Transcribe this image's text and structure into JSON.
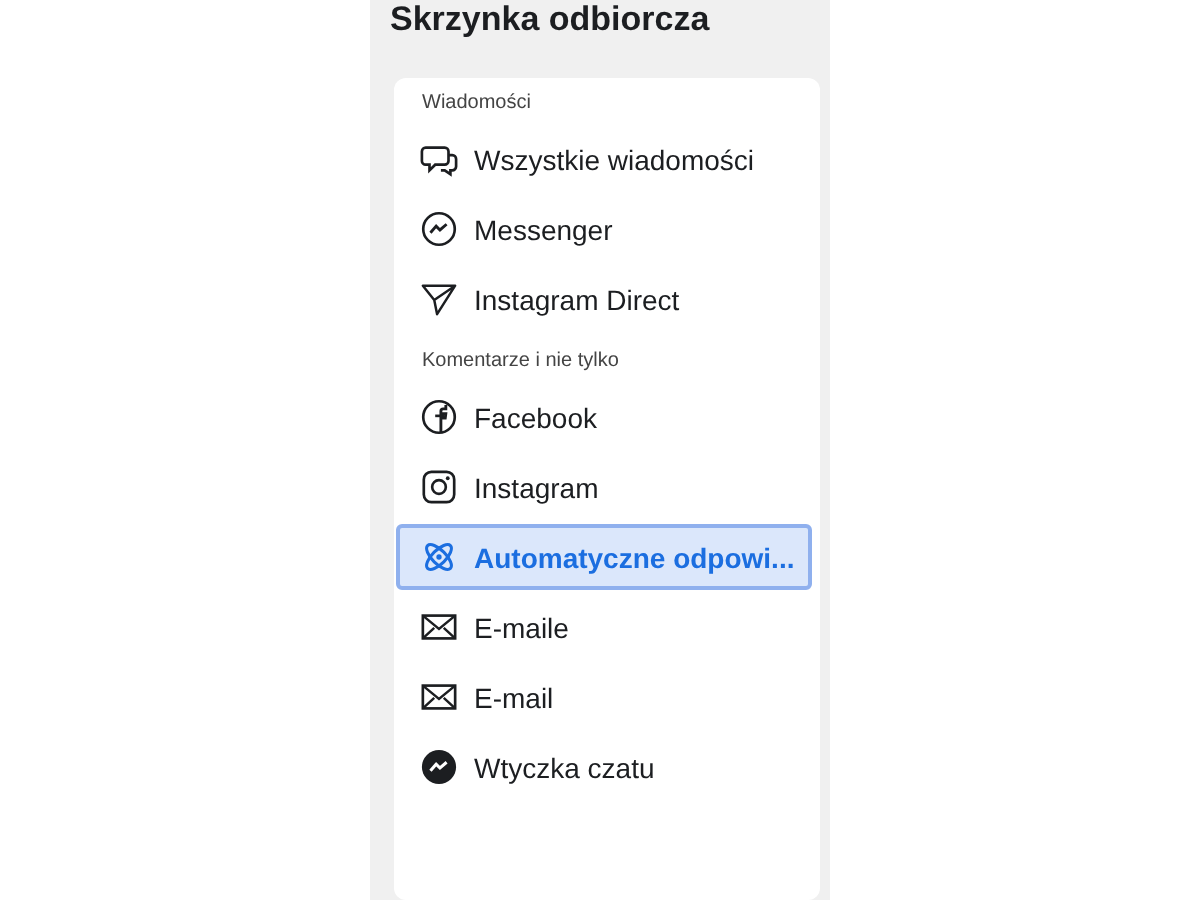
{
  "title": "Skrzynka odbiorcza",
  "sections": [
    {
      "heading": "Wiadomości",
      "items": [
        {
          "label": "Wszystkie wiadomości",
          "selected": false
        },
        {
          "label": "Messenger",
          "selected": false
        },
        {
          "label": "Instagram Direct",
          "selected": false
        }
      ]
    },
    {
      "heading": "Komentarze i nie tylko",
      "items": [
        {
          "label": "Facebook",
          "selected": false
        },
        {
          "label": "Instagram",
          "selected": false
        },
        {
          "label": "Automatyczne odpowi...",
          "selected": true
        },
        {
          "label": "E-maile",
          "selected": false
        },
        {
          "label": "E-mail",
          "selected": false
        },
        {
          "label": "Wtyczka czatu",
          "selected": false
        }
      ]
    }
  ]
}
